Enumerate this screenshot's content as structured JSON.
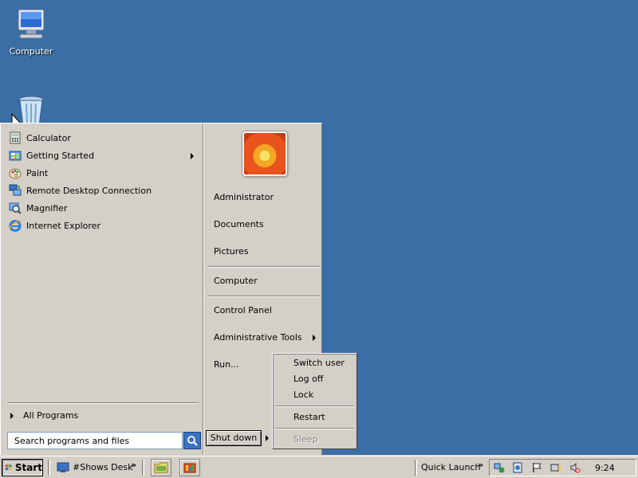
{
  "desktop": {
    "icons": [
      {
        "label": "Computer",
        "icon": "computer-icon"
      },
      {
        "label": "",
        "icon": "recycle-bin-icon"
      }
    ]
  },
  "start_menu": {
    "programs": [
      {
        "label": "Calculator",
        "icon": "calculator-icon",
        "submenu": false
      },
      {
        "label": "Getting Started",
        "icon": "getting-started-icon",
        "submenu": true
      },
      {
        "label": "Paint",
        "icon": "paint-icon",
        "submenu": false
      },
      {
        "label": "Remote Desktop Connection",
        "icon": "remote-desktop-icon",
        "submenu": false
      },
      {
        "label": "Magnifier",
        "icon": "magnifier-icon",
        "submenu": false
      },
      {
        "label": "Internet Explorer",
        "icon": "internet-explorer-icon",
        "submenu": false
      }
    ],
    "all_programs": "All Programs",
    "search_placeholder": "Search programs and files",
    "right": {
      "user": "Administrator",
      "documents": "Documents",
      "pictures": "Pictures",
      "computer": "Computer",
      "control_panel": "Control Panel",
      "admin_tools": "Administrative Tools",
      "run": "Run..."
    },
    "shutdown_label": "Shut down"
  },
  "shutdown_menu": {
    "switch_user": "Switch user",
    "log_off": "Log off",
    "lock": "Lock",
    "restart": "Restart",
    "sleep": "Sleep"
  },
  "taskbar": {
    "start": "Start",
    "shows_desk": "#Shows Desk",
    "quick_launch": "Quick Launch",
    "clock": "9:24"
  },
  "colors": {
    "desktop": "#3a6ea5",
    "face": "#d4d0c8"
  }
}
